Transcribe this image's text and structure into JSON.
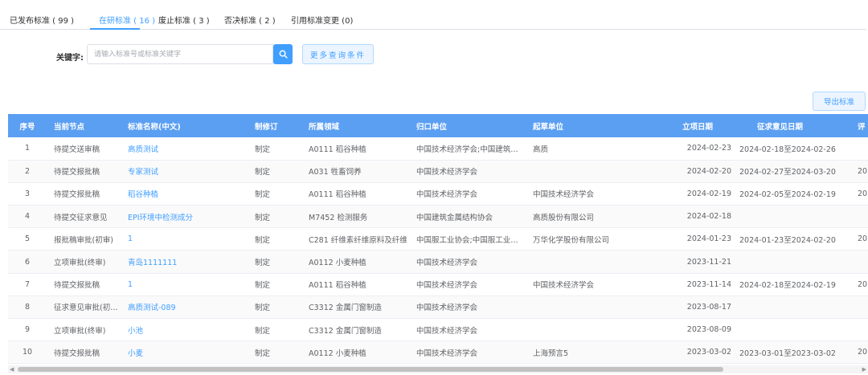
{
  "tabs": [
    {
      "label": "已发布标准 ( 99 )",
      "active": false
    },
    {
      "label": "在研标准 ( 16 )",
      "active": true
    },
    {
      "label": "废止标准 ( 3 )",
      "active": false
    },
    {
      "label": "否决标准 ( 2 )",
      "active": false
    },
    {
      "label": "引用标准变更 (0)",
      "active": false
    }
  ],
  "search": {
    "label": "关键字:",
    "placeholder": "请输入标准号或标准关键字",
    "value": "",
    "more_label": "更多查询条件"
  },
  "export_label": "导出标准",
  "table": {
    "columns": [
      "序号",
      "当前节点",
      "标准名称(中文)",
      "制修订",
      "所属领域",
      "归口单位",
      "起草单位",
      "立项日期",
      "征求意见日期",
      "评"
    ],
    "rows": [
      [
        "1",
        "待提交送审稿",
        "高质测试",
        "制定",
        "A0111 稻谷种植",
        "中国技术经济学会;中国建筑金属结构协会",
        "高质",
        "2024-02-23",
        "2024-02-18至2024-02-26",
        ""
      ],
      [
        "2",
        "待提交报批稿",
        "专家测试",
        "制定",
        "A031 牲畜饲养",
        "中国技术经济学会",
        "",
        "2024-02-20",
        "2024-02-27至2024-03-20",
        "20"
      ],
      [
        "3",
        "待提交报批稿",
        "稻谷种植",
        "制定",
        "A0111 稻谷种植",
        "中国技术经济学会",
        "中国技术经济学会",
        "2024-02-19",
        "2024-02-05至2024-02-19",
        "20"
      ],
      [
        "4",
        "待提交征求意见",
        "EPI环境中检测成分",
        "制定",
        "M7452 检测服务",
        "中国建筑金属结构协会",
        "高质股份有限公司",
        "2024-02-18",
        "",
        ""
      ],
      [
        "5",
        "报批稿审批(初审)",
        "1",
        "制定",
        "C281 纤维素纤维原料及纤维",
        "中国服工业协会;中国服工业协会",
        "万华化学股份有限公司",
        "2024-01-23",
        "2024-01-23至2024-02-20",
        "20"
      ],
      [
        "6",
        "立项审批(终审)",
        "青岛1111111",
        "制定",
        "A0112 小麦种植",
        "中国技术经济学会",
        "",
        "2023-11-21",
        "",
        ""
      ],
      [
        "7",
        "待提交报批稿",
        "1",
        "制定",
        "A0111 稻谷种植",
        "中国技术经济学会",
        "中国技术经济学会",
        "2023-11-14",
        "2024-02-18至2024-02-19",
        "20"
      ],
      [
        "8",
        "征求意见审批(初审)",
        "高质测试-089",
        "制定",
        "C3312 金属门窗制造",
        "中国技术经济学会",
        "",
        "2023-08-17",
        "",
        ""
      ],
      [
        "9",
        "立项审批(终审)",
        "小池",
        "制定",
        "C3312 金属门窗制造",
        "中国技术经济学会",
        "",
        "2023-08-09",
        "",
        ""
      ],
      [
        "10",
        "待提交报批稿",
        "小麦",
        "制定",
        "A0112 小麦种植",
        "中国技术经济学会",
        "上海预言5",
        "2023-03-02",
        "2023-03-01至2023-03-02",
        "20"
      ]
    ]
  }
}
